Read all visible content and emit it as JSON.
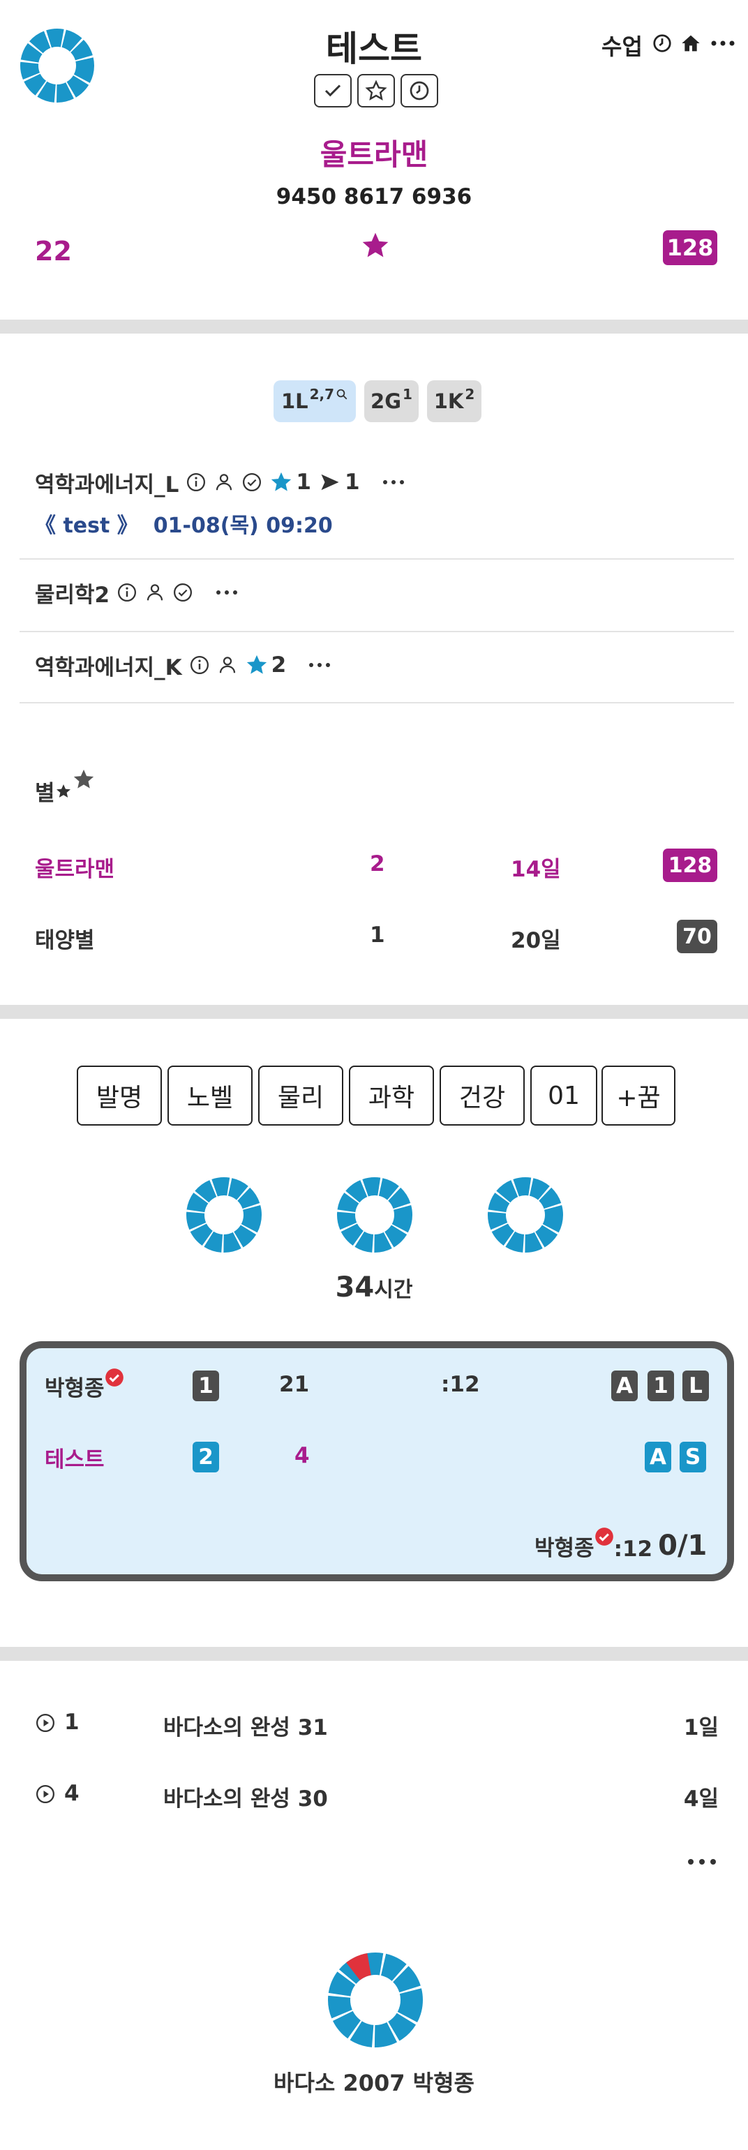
{
  "header": {
    "title": "테스트",
    "nav_label": "수업",
    "subtitle": "울트라맨",
    "code": "9450 8617 6936",
    "left_count": "22",
    "right_badge": "128"
  },
  "chips": [
    {
      "label": "1L",
      "sup": "2,7"
    },
    {
      "label": "2G",
      "sup": "1"
    },
    {
      "label": "1K",
      "sup": "2"
    }
  ],
  "courses": [
    {
      "name": "역학과에너지_L",
      "star_count": "1",
      "send_count": "1",
      "meta_prefix": "《 test 》",
      "meta_date": "01-08(목) 09:20"
    },
    {
      "name": "물리학2"
    },
    {
      "name": "역학과에너지_K",
      "star_count": "2"
    }
  ],
  "stars_section": {
    "heading": "별",
    "rows": [
      {
        "name": "울트라맨",
        "count": "2",
        "days": "14일",
        "badge": "128"
      },
      {
        "name": "태양별",
        "count": "1",
        "days": "20일",
        "badge": "70"
      }
    ]
  },
  "tags": [
    "발명",
    "노벨",
    "물리",
    "과학",
    "건강",
    "01",
    "+꿈"
  ],
  "hours": {
    "value": "34",
    "unit": "시간"
  },
  "match": {
    "row1": {
      "name": "박형종",
      "badge": "1",
      "score": "21",
      "time": ":12",
      "marks": [
        "A",
        "1",
        "L"
      ]
    },
    "row2": {
      "name": "테스트",
      "badge": "2",
      "score": "4",
      "marks": [
        "A",
        "S"
      ]
    },
    "footer": {
      "name": "박형종",
      "time": ":12",
      "ratio": "0/1"
    }
  },
  "history": [
    {
      "num": "1",
      "title": "바다소의 완성 31",
      "days": "1일"
    },
    {
      "num": "4",
      "title": "바다소의 완성 30",
      "days": "4일"
    }
  ],
  "footer": {
    "text": "바다소 2007 박형종"
  },
  "colors": {
    "accent_purple": "#a81c8c",
    "accent_cyan": "#1a96c9",
    "link_blue": "#2a4a8c",
    "badge_dark": "#4d4d4d",
    "alert_red": "#e0323c",
    "panel_bg": "#dff0fb"
  },
  "icons": [
    "ring-logo-icon",
    "check-icon",
    "star-outline-icon",
    "clock-icon",
    "home-icon",
    "more-icon",
    "info-icon",
    "person-icon",
    "check-circle-icon",
    "star-filled-icon",
    "send-icon",
    "play-circle-icon",
    "verified-icon"
  ]
}
